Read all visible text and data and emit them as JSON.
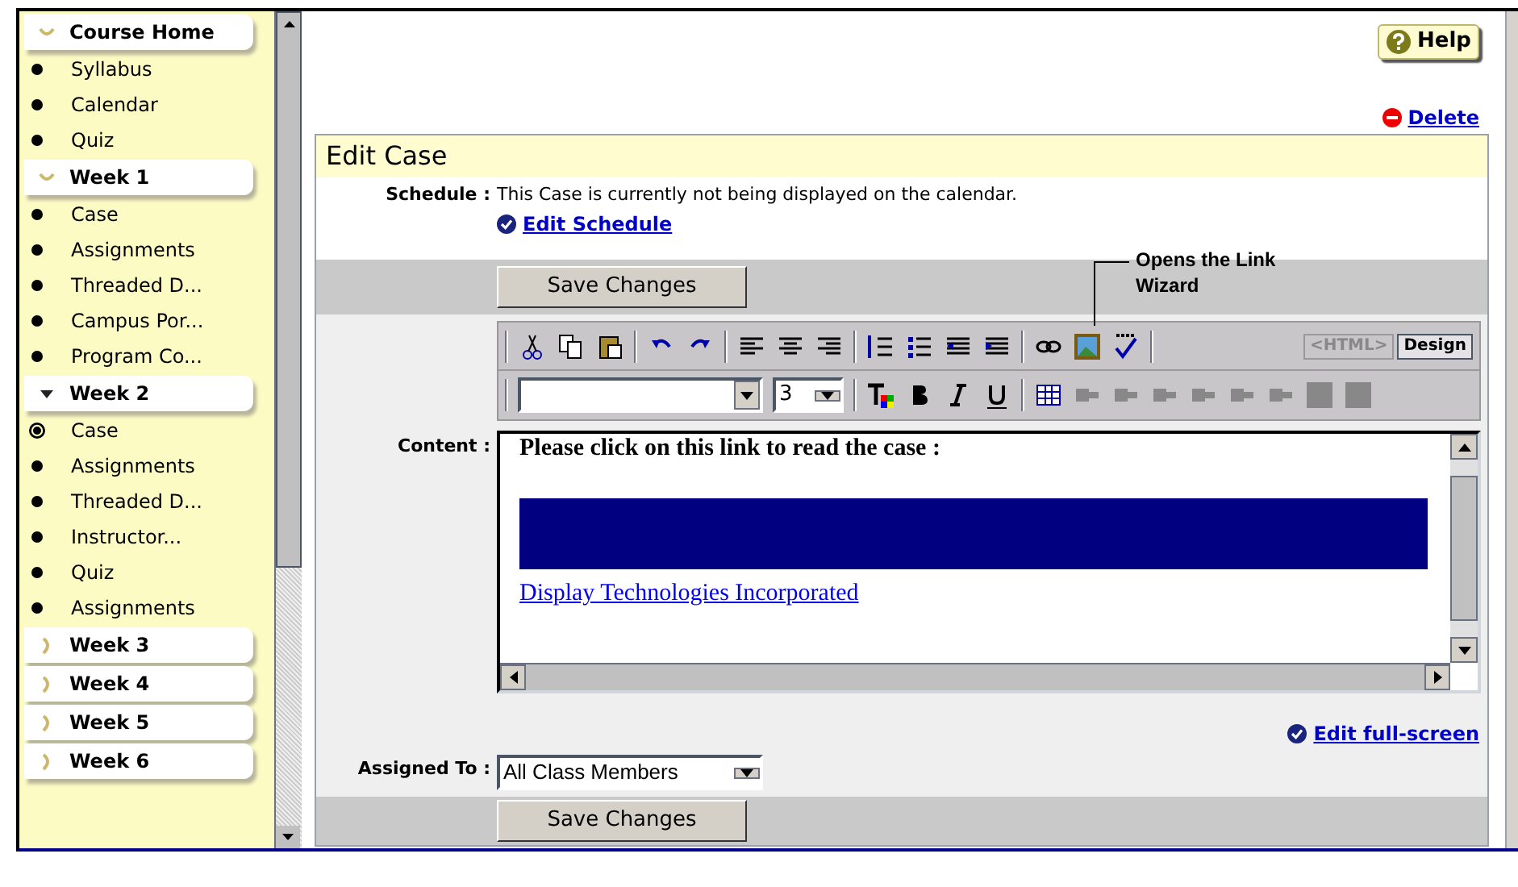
{
  "sidebar": {
    "sections": [
      {
        "label": "Course Home",
        "expanded": true,
        "current": false,
        "items": [
          {
            "label": "Syllabus",
            "selected": false
          },
          {
            "label": "Calendar",
            "selected": false
          },
          {
            "label": "Quiz",
            "selected": false
          }
        ]
      },
      {
        "label": "Week 1",
        "expanded": true,
        "current": false,
        "items": [
          {
            "label": "Case",
            "selected": false
          },
          {
            "label": "Assignments",
            "selected": false
          },
          {
            "label": "Threaded D...",
            "selected": false
          },
          {
            "label": "Campus Por...",
            "selected": false
          },
          {
            "label": "Program Co...",
            "selected": false
          }
        ]
      },
      {
        "label": "Week 2",
        "expanded": true,
        "current": true,
        "items": [
          {
            "label": "Case",
            "selected": true
          },
          {
            "label": "Assignments",
            "selected": false
          },
          {
            "label": "Threaded D...",
            "selected": false
          },
          {
            "label": "Instructor...",
            "selected": false
          },
          {
            "label": "Quiz",
            "selected": false
          },
          {
            "label": "Assignments",
            "selected": false
          }
        ]
      },
      {
        "label": "Week 3",
        "expanded": false,
        "current": false
      },
      {
        "label": "Week 4",
        "expanded": false,
        "current": false
      },
      {
        "label": "Week 5",
        "expanded": false,
        "current": false
      },
      {
        "label": "Week 6",
        "expanded": false,
        "current": false
      }
    ]
  },
  "help_button": "Help",
  "delete_link": "Delete",
  "panel": {
    "title": "Edit Case",
    "schedule": {
      "label": "Schedule :",
      "text": "This Case is currently not being displayed on the calendar.",
      "link": "Edit Schedule"
    },
    "save_button": "Save Changes",
    "callout": "Opens the Link Wizard",
    "editor": {
      "mode_tabs": [
        {
          "label": "<HTML>",
          "selected": false
        },
        {
          "label": "Design",
          "selected": true
        }
      ],
      "size_select": "3",
      "label": "Content :",
      "heading": "Please click on this link to read the case :",
      "link": "Display Technologies Incorporated"
    },
    "full_screen_link": "Edit full-screen",
    "assigned": {
      "label": "Assigned To :",
      "value": "All Class Members"
    },
    "save_button_bottom": "Save Changes"
  }
}
